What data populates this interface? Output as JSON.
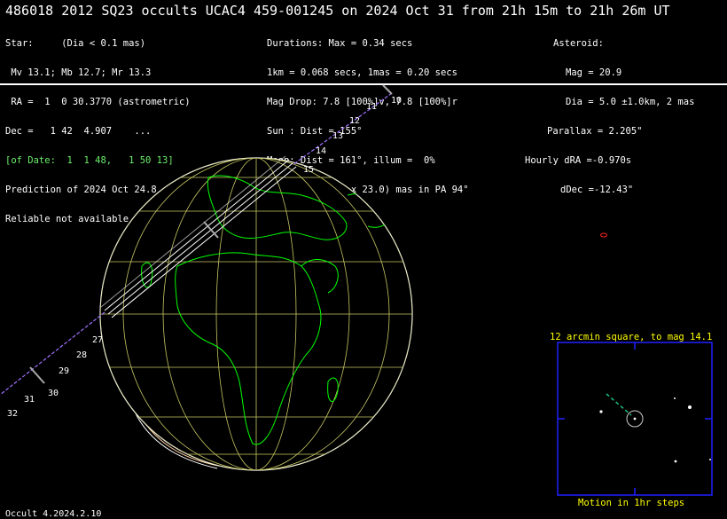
{
  "title": "486018 2012 SQ23 occults UCAC4 459-001245 on 2024 Oct 31 from 21h 15m to 21h 26m UT",
  "star": {
    "lines": [
      "Star:     (Dia < 0.1 mas)",
      " Mv 13.1; Mb 12.7; Mr 13.3",
      " RA =  1  0 30.3770 (astrometric)",
      "Dec =   1 42  4.907    ...",
      "[of Date:  1  1 48,   1 50 13]",
      "Prediction of 2024 Oct 24.8",
      "Reliable not available"
    ]
  },
  "event": {
    "lines": [
      "Durations: Max = 0.34 secs",
      "1km = 0.068 secs, 1mas = 0.20 secs",
      "Mag Drop: 7.8 [100%]v, 7.8 [100%]r",
      "Sun : Dist = 155°",
      "Moon: Dist = 161°, illum =  0%",
      "1σ Err: ±(43.0 x 23.0) mas in PA 94°"
    ]
  },
  "asteroid": {
    "lines": [
      "Asteroid:",
      "Mag = 20.9",
      "Dia = 5.0 ±1.0km, 2 mas",
      "Parallax = 2.205\"",
      "Hourly dRA =-0.970s",
      "dDec =-12.43\""
    ]
  },
  "path_ticks": [
    "10",
    "11",
    "12",
    "13",
    "14",
    "15",
    "27",
    "28",
    "29",
    "30",
    "31",
    "32"
  ],
  "finder_chart": {
    "title": "12 arcmin square, to mag 14.1",
    "footer": "Motion in 1hr steps"
  },
  "footer": "Occult 4.2024.2.10",
  "colors": {
    "background": "#000000",
    "text": "#ffffff",
    "coastline": "#00ff00",
    "graticule": "#c8c864",
    "path_line": "#a070ff",
    "finder_box": "#2020ff",
    "finder_text": "#ffff00"
  }
}
